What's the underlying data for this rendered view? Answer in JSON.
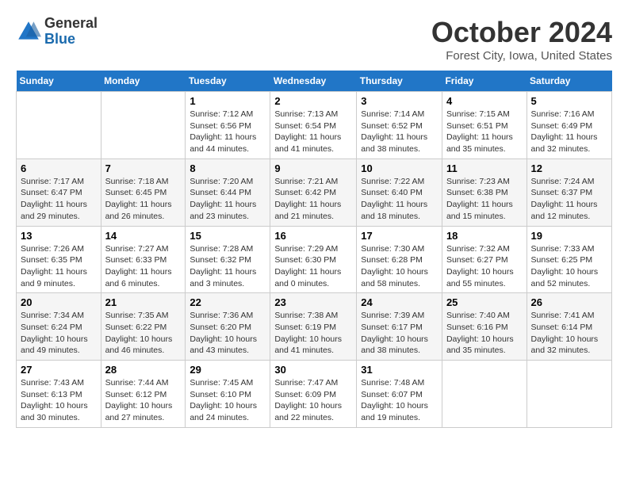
{
  "logo": {
    "general": "General",
    "blue": "Blue"
  },
  "title": "October 2024",
  "location": "Forest City, Iowa, United States",
  "days_of_week": [
    "Sunday",
    "Monday",
    "Tuesday",
    "Wednesday",
    "Thursday",
    "Friday",
    "Saturday"
  ],
  "weeks": [
    [
      {
        "day": "",
        "info": ""
      },
      {
        "day": "",
        "info": ""
      },
      {
        "day": "1",
        "info": "Sunrise: 7:12 AM\nSunset: 6:56 PM\nDaylight: 11 hours and 44 minutes."
      },
      {
        "day": "2",
        "info": "Sunrise: 7:13 AM\nSunset: 6:54 PM\nDaylight: 11 hours and 41 minutes."
      },
      {
        "day": "3",
        "info": "Sunrise: 7:14 AM\nSunset: 6:52 PM\nDaylight: 11 hours and 38 minutes."
      },
      {
        "day": "4",
        "info": "Sunrise: 7:15 AM\nSunset: 6:51 PM\nDaylight: 11 hours and 35 minutes."
      },
      {
        "day": "5",
        "info": "Sunrise: 7:16 AM\nSunset: 6:49 PM\nDaylight: 11 hours and 32 minutes."
      }
    ],
    [
      {
        "day": "6",
        "info": "Sunrise: 7:17 AM\nSunset: 6:47 PM\nDaylight: 11 hours and 29 minutes."
      },
      {
        "day": "7",
        "info": "Sunrise: 7:18 AM\nSunset: 6:45 PM\nDaylight: 11 hours and 26 minutes."
      },
      {
        "day": "8",
        "info": "Sunrise: 7:20 AM\nSunset: 6:44 PM\nDaylight: 11 hours and 23 minutes."
      },
      {
        "day": "9",
        "info": "Sunrise: 7:21 AM\nSunset: 6:42 PM\nDaylight: 11 hours and 21 minutes."
      },
      {
        "day": "10",
        "info": "Sunrise: 7:22 AM\nSunset: 6:40 PM\nDaylight: 11 hours and 18 minutes."
      },
      {
        "day": "11",
        "info": "Sunrise: 7:23 AM\nSunset: 6:38 PM\nDaylight: 11 hours and 15 minutes."
      },
      {
        "day": "12",
        "info": "Sunrise: 7:24 AM\nSunset: 6:37 PM\nDaylight: 11 hours and 12 minutes."
      }
    ],
    [
      {
        "day": "13",
        "info": "Sunrise: 7:26 AM\nSunset: 6:35 PM\nDaylight: 11 hours and 9 minutes."
      },
      {
        "day": "14",
        "info": "Sunrise: 7:27 AM\nSunset: 6:33 PM\nDaylight: 11 hours and 6 minutes."
      },
      {
        "day": "15",
        "info": "Sunrise: 7:28 AM\nSunset: 6:32 PM\nDaylight: 11 hours and 3 minutes."
      },
      {
        "day": "16",
        "info": "Sunrise: 7:29 AM\nSunset: 6:30 PM\nDaylight: 11 hours and 0 minutes."
      },
      {
        "day": "17",
        "info": "Sunrise: 7:30 AM\nSunset: 6:28 PM\nDaylight: 10 hours and 58 minutes."
      },
      {
        "day": "18",
        "info": "Sunrise: 7:32 AM\nSunset: 6:27 PM\nDaylight: 10 hours and 55 minutes."
      },
      {
        "day": "19",
        "info": "Sunrise: 7:33 AM\nSunset: 6:25 PM\nDaylight: 10 hours and 52 minutes."
      }
    ],
    [
      {
        "day": "20",
        "info": "Sunrise: 7:34 AM\nSunset: 6:24 PM\nDaylight: 10 hours and 49 minutes."
      },
      {
        "day": "21",
        "info": "Sunrise: 7:35 AM\nSunset: 6:22 PM\nDaylight: 10 hours and 46 minutes."
      },
      {
        "day": "22",
        "info": "Sunrise: 7:36 AM\nSunset: 6:20 PM\nDaylight: 10 hours and 43 minutes."
      },
      {
        "day": "23",
        "info": "Sunrise: 7:38 AM\nSunset: 6:19 PM\nDaylight: 10 hours and 41 minutes."
      },
      {
        "day": "24",
        "info": "Sunrise: 7:39 AM\nSunset: 6:17 PM\nDaylight: 10 hours and 38 minutes."
      },
      {
        "day": "25",
        "info": "Sunrise: 7:40 AM\nSunset: 6:16 PM\nDaylight: 10 hours and 35 minutes."
      },
      {
        "day": "26",
        "info": "Sunrise: 7:41 AM\nSunset: 6:14 PM\nDaylight: 10 hours and 32 minutes."
      }
    ],
    [
      {
        "day": "27",
        "info": "Sunrise: 7:43 AM\nSunset: 6:13 PM\nDaylight: 10 hours and 30 minutes."
      },
      {
        "day": "28",
        "info": "Sunrise: 7:44 AM\nSunset: 6:12 PM\nDaylight: 10 hours and 27 minutes."
      },
      {
        "day": "29",
        "info": "Sunrise: 7:45 AM\nSunset: 6:10 PM\nDaylight: 10 hours and 24 minutes."
      },
      {
        "day": "30",
        "info": "Sunrise: 7:47 AM\nSunset: 6:09 PM\nDaylight: 10 hours and 22 minutes."
      },
      {
        "day": "31",
        "info": "Sunrise: 7:48 AM\nSunset: 6:07 PM\nDaylight: 10 hours and 19 minutes."
      },
      {
        "day": "",
        "info": ""
      },
      {
        "day": "",
        "info": ""
      }
    ]
  ]
}
